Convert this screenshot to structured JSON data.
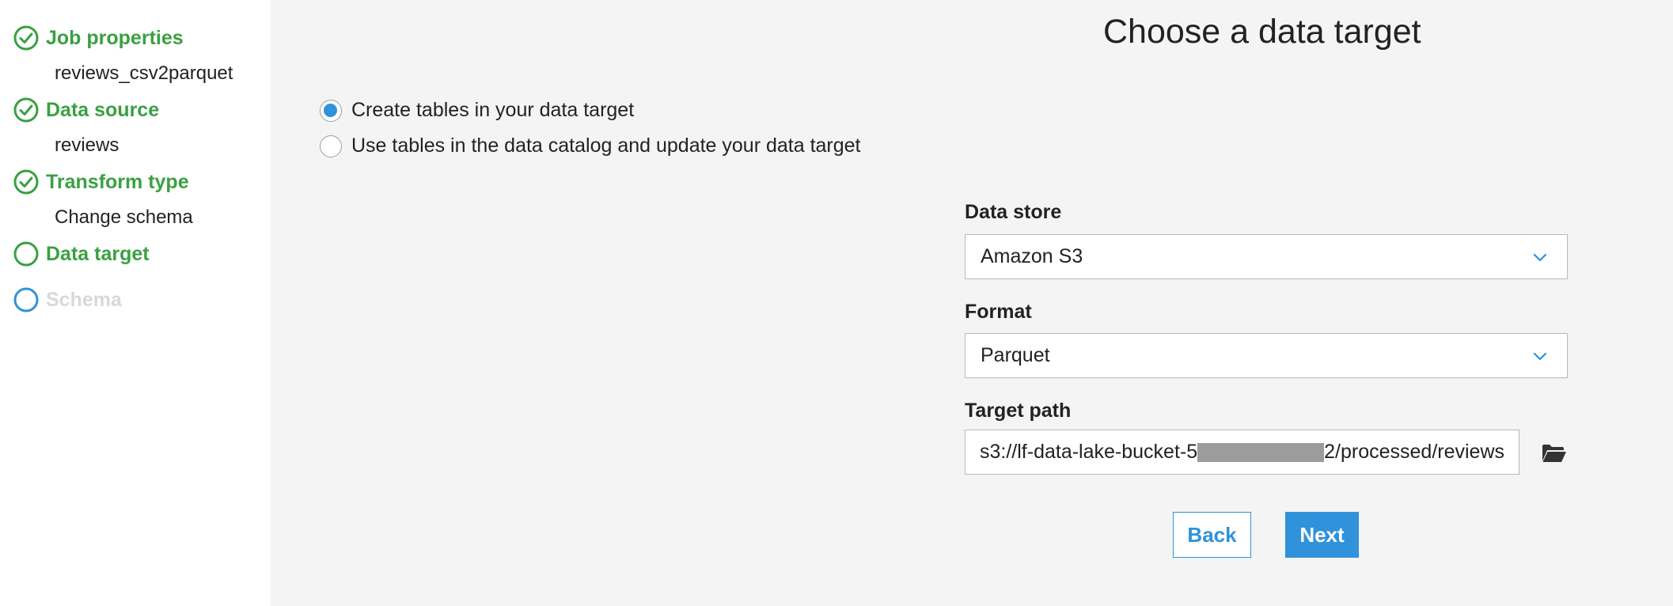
{
  "sidebar": {
    "steps": [
      {
        "label": "Job properties",
        "value": "reviews_csv2parquet",
        "status": "complete"
      },
      {
        "label": "Data source",
        "value": "reviews",
        "status": "complete"
      },
      {
        "label": "Transform type",
        "value": "Change schema",
        "status": "complete"
      },
      {
        "label": "Data target",
        "status": "current"
      },
      {
        "label": "Schema",
        "status": "pending"
      }
    ]
  },
  "main": {
    "title": "Choose a data target",
    "options": [
      {
        "label": "Create tables in your data target",
        "checked": true
      },
      {
        "label": "Use tables in the data catalog and update your data target",
        "checked": false
      }
    ],
    "data_store": {
      "label": "Data store",
      "value": "Amazon S3"
    },
    "format": {
      "label": "Format",
      "value": "Parquet"
    },
    "target_path": {
      "label": "Target path",
      "prefix": "s3://lf-data-lake-bucket-5",
      "suffix": "2/processed/reviews"
    },
    "buttons": {
      "back": "Back",
      "next": "Next"
    }
  },
  "colors": {
    "accent": "#2f92da",
    "complete": "#3aa042",
    "pending": "#d6d9dc",
    "background": "#f3f4f3"
  },
  "icons": {
    "complete": "check-circle-icon",
    "current": "circle-outline-icon",
    "pending": "circle-outline-icon",
    "select": "chevron-down-icon",
    "browse": "folder-open-icon"
  }
}
